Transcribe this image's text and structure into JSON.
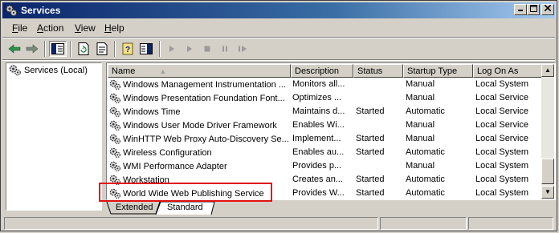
{
  "window": {
    "title": "Services"
  },
  "menu": [
    {
      "pre": "",
      "key": "F",
      "post": "ile"
    },
    {
      "pre": "",
      "key": "A",
      "post": "ction"
    },
    {
      "pre": "",
      "key": "V",
      "post": "iew"
    },
    {
      "pre": "",
      "key": "H",
      "post": "elp"
    }
  ],
  "tree": {
    "root_label": "Services (Local)"
  },
  "columns": {
    "name": "Name",
    "description": "Description",
    "status": "Status",
    "startup_type": "Startup Type",
    "log_on_as": "Log On As"
  },
  "rows": [
    {
      "name": "Windows Management Instrumentation ...",
      "description": "Monitors all...",
      "status": "",
      "startup_type": "Manual",
      "log_on_as": "Local System"
    },
    {
      "name": "Windows Presentation Foundation Font...",
      "description": "Optimizes ...",
      "status": "",
      "startup_type": "Manual",
      "log_on_as": "Local Service"
    },
    {
      "name": "Windows Time",
      "description": "Maintains d...",
      "status": "Started",
      "startup_type": "Automatic",
      "log_on_as": "Local Service"
    },
    {
      "name": "Windows User Mode Driver Framework",
      "description": "Enables Wi...",
      "status": "",
      "startup_type": "Manual",
      "log_on_as": "Local Service"
    },
    {
      "name": "WinHTTP Web Proxy Auto-Discovery Se...",
      "description": "Implement...",
      "status": "Started",
      "startup_type": "Manual",
      "log_on_as": "Local Service"
    },
    {
      "name": "Wireless Configuration",
      "description": "Enables au...",
      "status": "Started",
      "startup_type": "Automatic",
      "log_on_as": "Local System"
    },
    {
      "name": "WMI Performance Adapter",
      "description": "Provides p...",
      "status": "",
      "startup_type": "Manual",
      "log_on_as": "Local System"
    },
    {
      "name": "Workstation",
      "description": "Creates an...",
      "status": "Started",
      "startup_type": "Automatic",
      "log_on_as": "Local System"
    },
    {
      "name": "World Wide Web Publishing Service",
      "description": "Provides W...",
      "status": "Started",
      "startup_type": "Automatic",
      "log_on_as": "Local System"
    }
  ],
  "tabs": {
    "extended": "Extended",
    "standard": "Standard"
  },
  "colors": {
    "highlight": "#e01010",
    "title_start": "#0a246a",
    "title_end": "#a6caf0"
  }
}
